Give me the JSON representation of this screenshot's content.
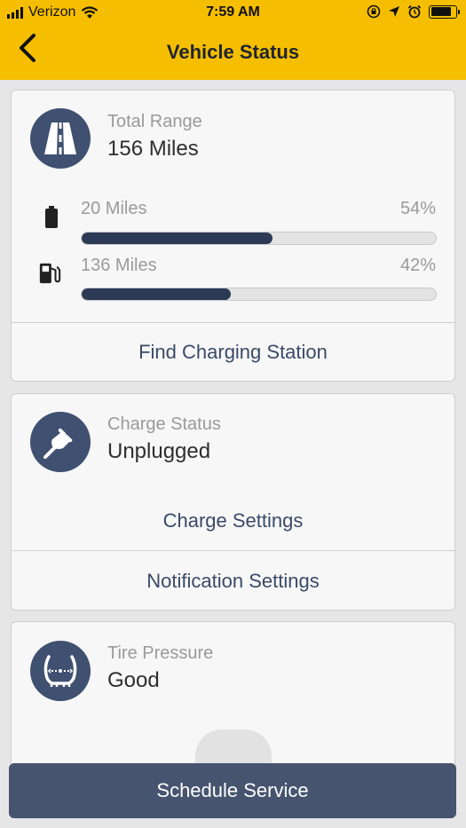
{
  "status_bar": {
    "carrier": "Verizon",
    "time": "7:59 AM",
    "battery_level": 0.85,
    "icons": [
      "signal-icon",
      "wifi-icon",
      "rotation-lock-icon",
      "location-icon",
      "alarm-icon",
      "battery-icon"
    ]
  },
  "nav": {
    "title": "Vehicle Status",
    "back_icon": "chevron-left-icon"
  },
  "range_card": {
    "icon": "road-icon",
    "label": "Total Range",
    "value": "156 Miles",
    "battery": {
      "icon": "battery-icon",
      "miles": "20 Miles",
      "percent": "54%",
      "level": 0.54
    },
    "fuel": {
      "icon": "fuel-pump-icon",
      "miles": "136 Miles",
      "percent": "42%",
      "level": 0.42
    },
    "action": "Find Charging Station"
  },
  "charge_card": {
    "icon": "plug-icon",
    "label": "Charge Status",
    "value": "Unplugged",
    "action_primary": "Charge Settings",
    "action_secondary": "Notification Settings"
  },
  "tire_card": {
    "icon": "tire-pressure-icon",
    "label": "Tire Pressure",
    "value": "Good"
  },
  "footer": {
    "button": "Schedule Service"
  },
  "colors": {
    "brand_yellow": "#f5be00",
    "accent_navy": "#3f5070",
    "bar_fill": "#2c3a55",
    "button_bg": "#46546f"
  }
}
